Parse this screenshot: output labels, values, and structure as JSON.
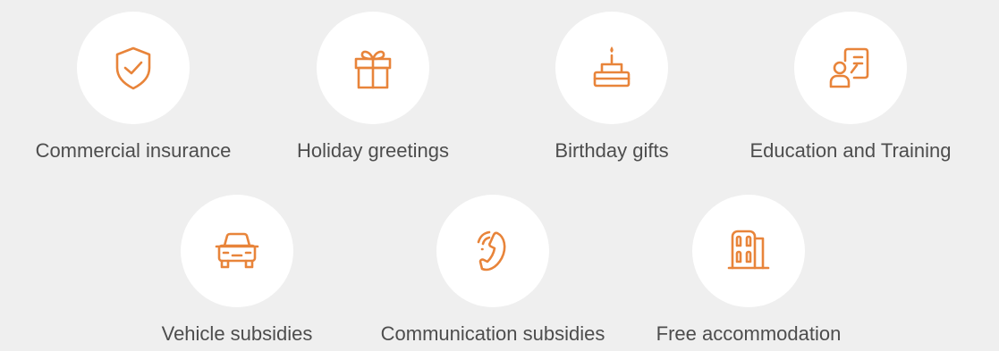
{
  "benefits": [
    {
      "label": "Commercial insurance",
      "icon": "shield-check-icon"
    },
    {
      "label": "Holiday greetings",
      "icon": "gift-box-icon"
    },
    {
      "label": "Birthday gifts",
      "icon": "birthday-cake-icon"
    },
    {
      "label": "Education and Training",
      "icon": "teacher-board-icon"
    },
    {
      "label": "Vehicle subsidies",
      "icon": "car-icon"
    },
    {
      "label": "Communication subsidies",
      "icon": "phone-call-icon"
    },
    {
      "label": "Free accommodation",
      "icon": "building-icon"
    }
  ],
  "colors": {
    "accent": "#e8843a",
    "background": "#efefef",
    "circle": "#ffffff",
    "text": "#4d4d4d"
  }
}
